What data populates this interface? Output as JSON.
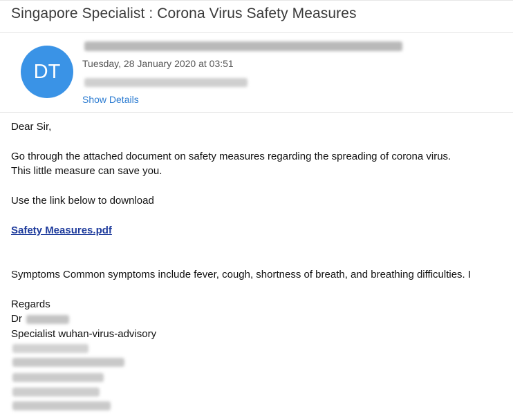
{
  "email": {
    "subject": "Singapore Specialist  : Corona Virus Safety Measures",
    "avatar_initials": "DT",
    "date": "Tuesday, 28 January 2020 at 03:51",
    "show_details": "Show Details"
  },
  "body": {
    "greeting": "Dear Sir,",
    "para1_line1": "Go through the attached document on safety measures regarding the spreading of corona virus.",
    "para1_line2": "This little measure can save you.",
    "link_intro": "Use the link below to download",
    "attachment_link": "Safety Measures.pdf",
    "symptoms": "Symptoms  Common symptoms include fever, cough, shortness of breath, and breathing difficulties. I",
    "regards": "Regards",
    "sign_prefix": "Dr",
    "signature_line": "Specialist wuhan-virus-advisory"
  },
  "colors": {
    "avatar": "#3a93e6",
    "link": "#1e3b9c",
    "show_details": "#2b7bd1"
  }
}
